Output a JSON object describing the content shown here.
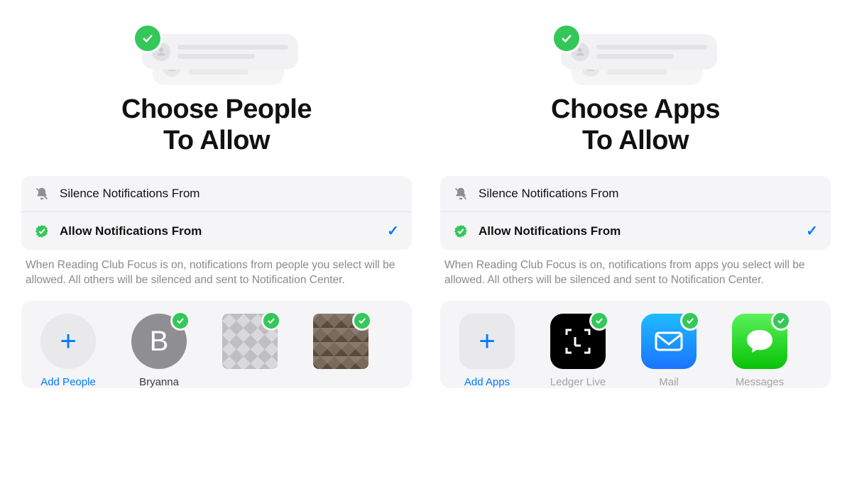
{
  "left": {
    "title_line1": "Choose People",
    "title_line2": "To Allow",
    "options": {
      "silence_label": "Silence Notifications From",
      "allow_label": "Allow Notifications From",
      "selected": "allow"
    },
    "explain": "When Reading Club Focus is on, notifications from people you select will be allowed. All others will be silenced and sent to Notification Center.",
    "add_label": "Add People",
    "people": [
      {
        "name": "Bryanna",
        "initial": "B",
        "checked": true
      },
      {
        "name": "",
        "checked": true,
        "pixelated": true
      },
      {
        "name": "",
        "checked": true,
        "pixelated": true
      }
    ]
  },
  "right": {
    "title_line1": "Choose Apps",
    "title_line2": "To Allow",
    "options": {
      "silence_label": "Silence Notifications From",
      "allow_label": "Allow Notifications From",
      "selected": "allow"
    },
    "explain": "When Reading Club Focus is on, notifications from apps you select will be allowed. All others will be silenced and sent to Notification Center.",
    "add_label": "Add Apps",
    "apps": [
      {
        "name": "Ledger Live",
        "checked": true
      },
      {
        "name": "Mail",
        "checked": true
      },
      {
        "name": "Messages",
        "checked": true
      }
    ]
  },
  "colors": {
    "accent_green": "#34c759",
    "accent_blue": "#007aff"
  }
}
